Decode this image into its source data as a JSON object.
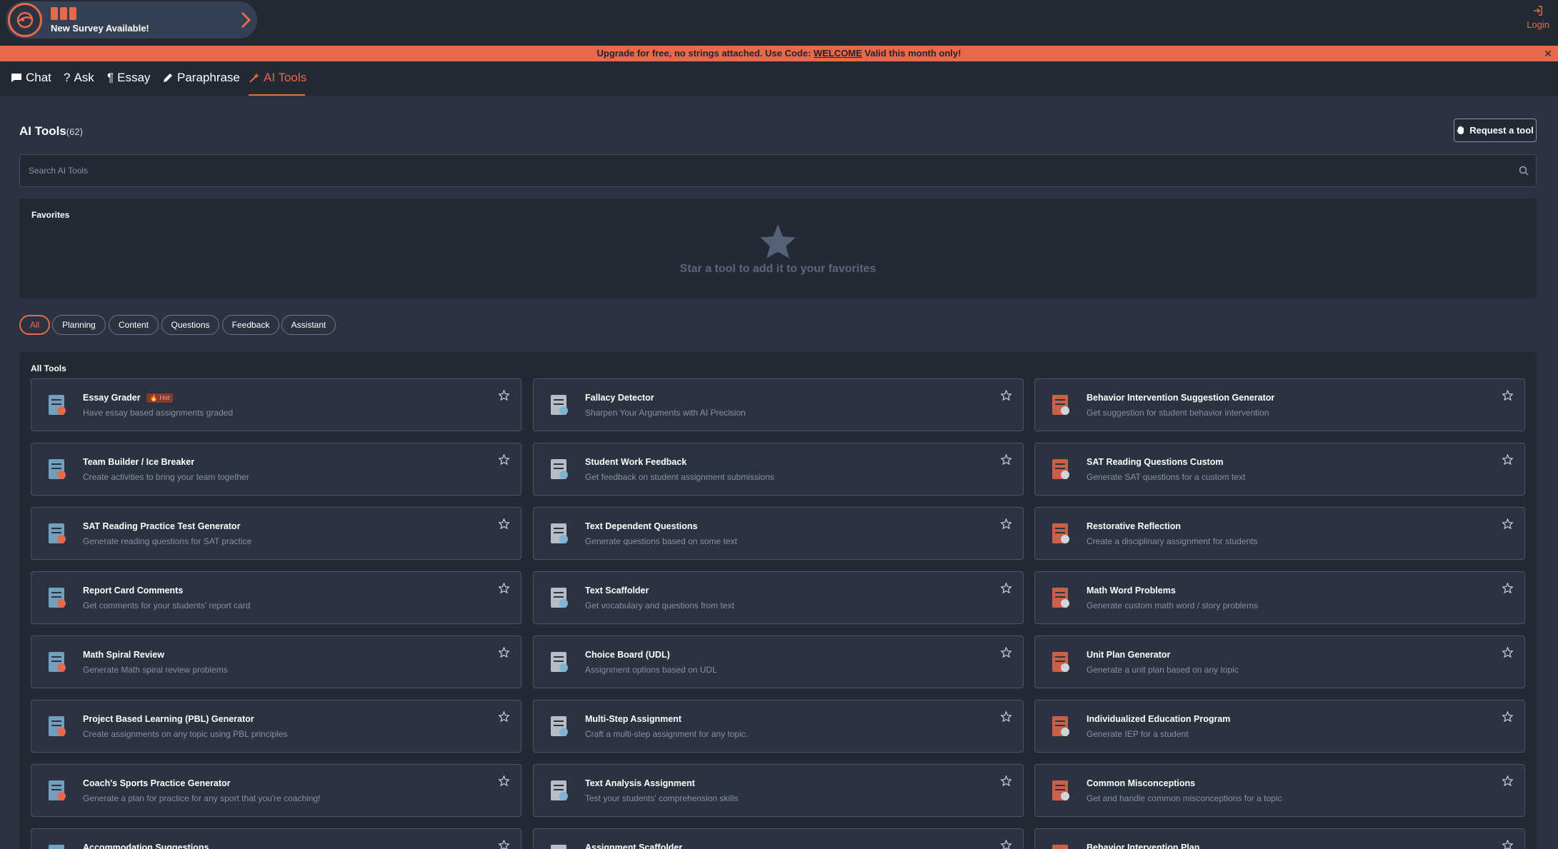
{
  "survey": {
    "label": "New Survey Available!"
  },
  "login": {
    "label": "Login"
  },
  "promo": {
    "prefix": "Upgrade for free, no strings attached. Use Code: ",
    "code": "WELCOME",
    "suffix": " Valid this month only!",
    "close": "✕"
  },
  "nav": {
    "tabs": [
      {
        "label": "Chat",
        "icon": "chat-icon"
      },
      {
        "label": "Ask",
        "icon": "question-icon"
      },
      {
        "label": "Essay",
        "icon": "paragraph-icon"
      },
      {
        "label": "Paraphrase",
        "icon": "pencil-icon"
      },
      {
        "label": "AI Tools",
        "icon": "magic-wand-icon",
        "active": true
      }
    ]
  },
  "header": {
    "title": "AI Tools",
    "count": "(62)",
    "request_label": "Request a tool"
  },
  "search": {
    "placeholder": "Search AI Tools"
  },
  "favorites": {
    "title": "Favorites",
    "empty_text": "Star a tool to add it to your favorites"
  },
  "filters": [
    "All",
    "Planning",
    "Content",
    "Questions",
    "Feedback",
    "Assistant"
  ],
  "tools": {
    "title": "All Tools",
    "hot_label": "Hot",
    "items": [
      {
        "title": "Essay Grader",
        "desc": "Have essay based assignments graded",
        "hot": true
      },
      {
        "title": "Fallacy Detector",
        "desc": "Sharpen Your Arguments with AI Precision"
      },
      {
        "title": "Behavior Intervention Suggestion Generator",
        "desc": "Get suggestion for student behavior intervention"
      },
      {
        "title": "Team Builder / Ice Breaker",
        "desc": "Create activities to bring your team together"
      },
      {
        "title": "Student Work Feedback",
        "desc": "Get feedback on student assignment submissions"
      },
      {
        "title": "SAT Reading Questions Custom",
        "desc": "Generate SAT questions for a custom text"
      },
      {
        "title": "SAT Reading Practice Test Generator",
        "desc": "Generate reading questions for SAT practice"
      },
      {
        "title": "Text Dependent Questions",
        "desc": "Generate questions based on some text"
      },
      {
        "title": "Restorative Reflection",
        "desc": "Create a disciplinary assignment for students"
      },
      {
        "title": "Report Card Comments",
        "desc": "Get comments for your students' report card"
      },
      {
        "title": "Text Scaffolder",
        "desc": "Get vocabulary and questions from text"
      },
      {
        "title": "Math Word Problems",
        "desc": "Generate custom math word / story problems"
      },
      {
        "title": "Math Spiral Review",
        "desc": "Generate Math spiral review problems"
      },
      {
        "title": "Choice Board (UDL)",
        "desc": "Assignment options based on UDL"
      },
      {
        "title": "Unit Plan Generator",
        "desc": "Generate a unit plan based on any topic"
      },
      {
        "title": "Project Based Learning (PBL) Generator",
        "desc": "Create assignments on any topic using PBL principles"
      },
      {
        "title": "Multi-Step Assignment",
        "desc": "Craft a multi-step assignment for any topic."
      },
      {
        "title": "Individualized Education Program",
        "desc": "Generate IEP for a student"
      },
      {
        "title": "Coach's Sports Practice Generator",
        "desc": "Generate a plan for practice for any sport that you're coaching!"
      },
      {
        "title": "Text Analysis Assignment",
        "desc": "Test your students' comprehension skills"
      },
      {
        "title": "Common Misconceptions",
        "desc": "Get and handle common misconceptions for a topic"
      },
      {
        "title": "Accommodation Suggestions",
        "desc": ""
      },
      {
        "title": "Assignment Scaffolder",
        "desc": ""
      },
      {
        "title": "Behavior Intervention Plan",
        "desc": ""
      }
    ]
  },
  "colors": {
    "accent": "#e8684a",
    "background": "#2b3340",
    "panel": "#232a35"
  }
}
